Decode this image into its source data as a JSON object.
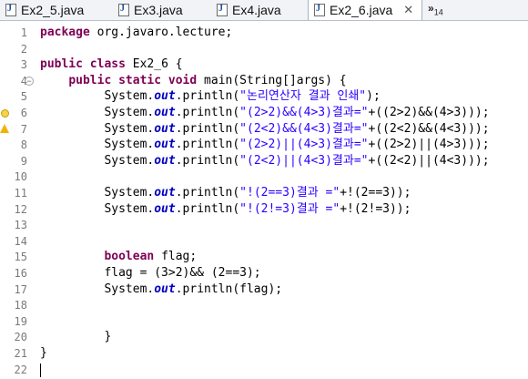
{
  "tabs": [
    {
      "label": "Ex2_5.java",
      "active": false
    },
    {
      "label": "Ex3.java",
      "active": false
    },
    {
      "label": "Ex4.java",
      "active": false
    },
    {
      "label": "Ex2_6.java",
      "active": true
    }
  ],
  "overflow": {
    "symbol": "»",
    "count": "14"
  },
  "close_symbol": "✕",
  "lines": [
    {
      "n": "1",
      "tokens": [
        [
          "kw",
          "package"
        ],
        [
          "t",
          " org.javaro.lecture;"
        ]
      ]
    },
    {
      "n": "2",
      "tokens": []
    },
    {
      "n": "3",
      "tokens": [
        [
          "kw",
          "public"
        ],
        [
          "t",
          " "
        ],
        [
          "kw",
          "class"
        ],
        [
          "t",
          " Ex2_6 {"
        ]
      ]
    },
    {
      "n": "4",
      "tokens": [
        [
          "t",
          "    "
        ],
        [
          "kw",
          "public"
        ],
        [
          "t",
          " "
        ],
        [
          "kw",
          "static"
        ],
        [
          "t",
          " "
        ],
        [
          "kw",
          "void"
        ],
        [
          "t",
          " main(String[]args) {"
        ]
      ]
    },
    {
      "n": "5",
      "tokens": [
        [
          "t",
          "         System."
        ],
        [
          "fld",
          "out"
        ],
        [
          "t",
          ".println("
        ],
        [
          "str",
          "\"논리연산자 결과 인쇄\""
        ],
        [
          "t",
          ");"
        ]
      ]
    },
    {
      "n": "6",
      "tokens": [
        [
          "t",
          "         System."
        ],
        [
          "fld",
          "out"
        ],
        [
          "t",
          ".println("
        ],
        [
          "str",
          "\"(2>2)&&(4>3)결과=\""
        ],
        [
          "t",
          "+((2>2)&&(4>3)));"
        ]
      ]
    },
    {
      "n": "7",
      "tokens": [
        [
          "t",
          "         System."
        ],
        [
          "fld",
          "out"
        ],
        [
          "t",
          ".println("
        ],
        [
          "str",
          "\"(2<2)&&(4<3)결과=\""
        ],
        [
          "t",
          "+((2<2)&&(4<3)));"
        ]
      ]
    },
    {
      "n": "8",
      "tokens": [
        [
          "t",
          "         System."
        ],
        [
          "fld",
          "out"
        ],
        [
          "t",
          ".println("
        ],
        [
          "str",
          "\"(2>2)||(4>3)결과=\""
        ],
        [
          "t",
          "+((2>2)||(4>3)));"
        ]
      ]
    },
    {
      "n": "9",
      "tokens": [
        [
          "t",
          "         System."
        ],
        [
          "fld",
          "out"
        ],
        [
          "t",
          ".println("
        ],
        [
          "str",
          "\"(2<2)||(4<3)결과=\""
        ],
        [
          "t",
          "+((2<2)||(4<3)));"
        ]
      ]
    },
    {
      "n": "10",
      "tokens": []
    },
    {
      "n": "11",
      "tokens": [
        [
          "t",
          "         System."
        ],
        [
          "fld",
          "out"
        ],
        [
          "t",
          ".println("
        ],
        [
          "str",
          "\"!(2==3)결과 =\""
        ],
        [
          "t",
          "+!(2==3));"
        ]
      ]
    },
    {
      "n": "12",
      "tokens": [
        [
          "t",
          "         System."
        ],
        [
          "fld",
          "out"
        ],
        [
          "t",
          ".println("
        ],
        [
          "str",
          "\"!(2!=3)결과 =\""
        ],
        [
          "t",
          "+!(2!=3));"
        ]
      ]
    },
    {
      "n": "13",
      "tokens": []
    },
    {
      "n": "14",
      "tokens": []
    },
    {
      "n": "15",
      "tokens": [
        [
          "t",
          "         "
        ],
        [
          "kw",
          "boolean"
        ],
        [
          "t",
          " flag;"
        ]
      ]
    },
    {
      "n": "16",
      "tokens": [
        [
          "t",
          "         flag = (3>2)&& (2==3);"
        ]
      ]
    },
    {
      "n": "17",
      "tokens": [
        [
          "t",
          "         System."
        ],
        [
          "fld",
          "out"
        ],
        [
          "t",
          ".println(flag);"
        ]
      ]
    },
    {
      "n": "18",
      "tokens": []
    },
    {
      "n": "19",
      "tokens": []
    },
    {
      "n": "20",
      "tokens": [
        [
          "t",
          "         }"
        ]
      ]
    },
    {
      "n": "21",
      "tokens": [
        [
          "t",
          "}"
        ]
      ]
    },
    {
      "n": "22",
      "tokens": []
    }
  ]
}
